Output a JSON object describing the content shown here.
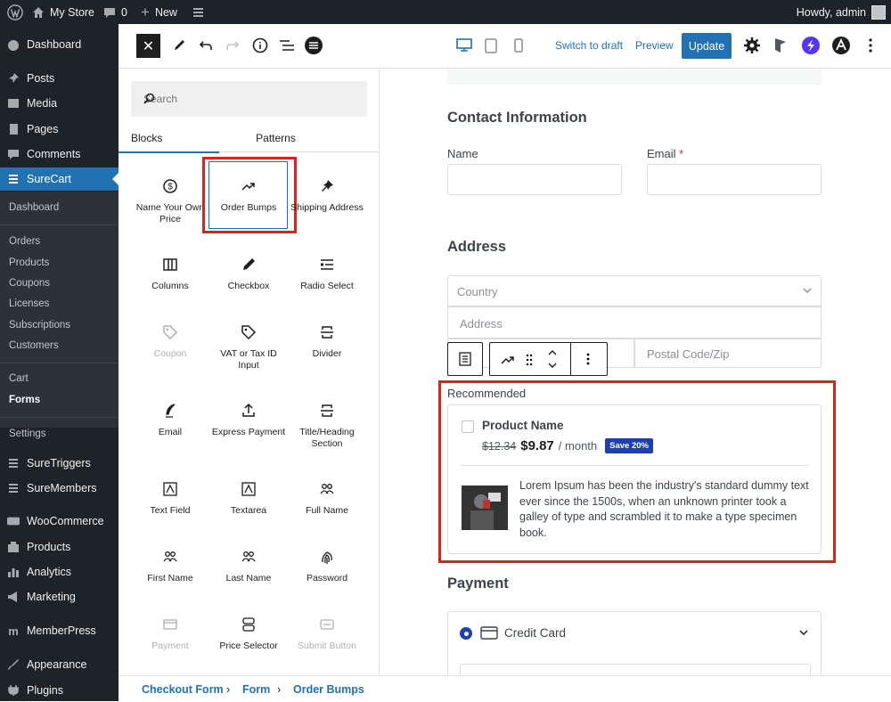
{
  "adminbar": {
    "site": "My Store",
    "comments": "0",
    "new": "New",
    "howdy": "Howdy, admin"
  },
  "menu": {
    "items": [
      "Dashboard",
      "Posts",
      "Media",
      "Pages",
      "Comments",
      "SureCart"
    ],
    "surecart_sub": [
      "Dashboard",
      "Orders",
      "Products",
      "Coupons",
      "Licenses",
      "Subscriptions",
      "Customers",
      "Cart",
      "Forms",
      "Settings"
    ],
    "items2": [
      "SureTriggers",
      "SureMembers",
      "WooCommerce",
      "Products",
      "Analytics",
      "Marketing",
      "MemberPress",
      "Appearance",
      "Plugins"
    ]
  },
  "header": {
    "switch_draft": "Switch to draft",
    "preview": "Preview",
    "update": "Update"
  },
  "inserter": {
    "search_placeholder": "Search",
    "tabs": [
      "Blocks",
      "Patterns"
    ],
    "blocks": [
      "Name Your Own Price",
      "Order Bumps",
      "Shipping Address",
      "Columns",
      "Checkbox",
      "Radio Select",
      "Coupon",
      "VAT or Tax ID Input",
      "Divider",
      "Email",
      "Express Payment",
      "Title/Heading Section",
      "Text Field",
      "Textarea",
      "Full Name",
      "First Name",
      "Last Name",
      "Password",
      "Payment",
      "Price Selector",
      "Submit Button"
    ]
  },
  "form": {
    "contact_title": "Contact Information",
    "name_label": "Name",
    "email_label": "Email",
    "required_mark": "*",
    "address_title": "Address",
    "country_placeholder": "Country",
    "address_placeholder": "Address",
    "postal_placeholder": "Postal Code/Zip",
    "bump": {
      "heading": "Recommended",
      "product_name": "Product Name",
      "old_price": "$12.34",
      "price": "$9.87",
      "period": "/ month",
      "badge": "Save 20%",
      "description": "Lorem Ipsum has been the industry's standard dummy text ever since the 1500s, when an unknown printer took a galley of type and scrambled it to make a type specimen book."
    },
    "payment_title": "Payment",
    "payment_method": "Credit Card"
  },
  "breadcrumb": [
    "Checkout Form",
    "Form",
    "Order Bumps"
  ],
  "colors": {
    "accent": "#2271b1",
    "highlight": "#d9231d",
    "admin_bg": "#1d2327",
    "badge_bg": "#1e40af"
  }
}
